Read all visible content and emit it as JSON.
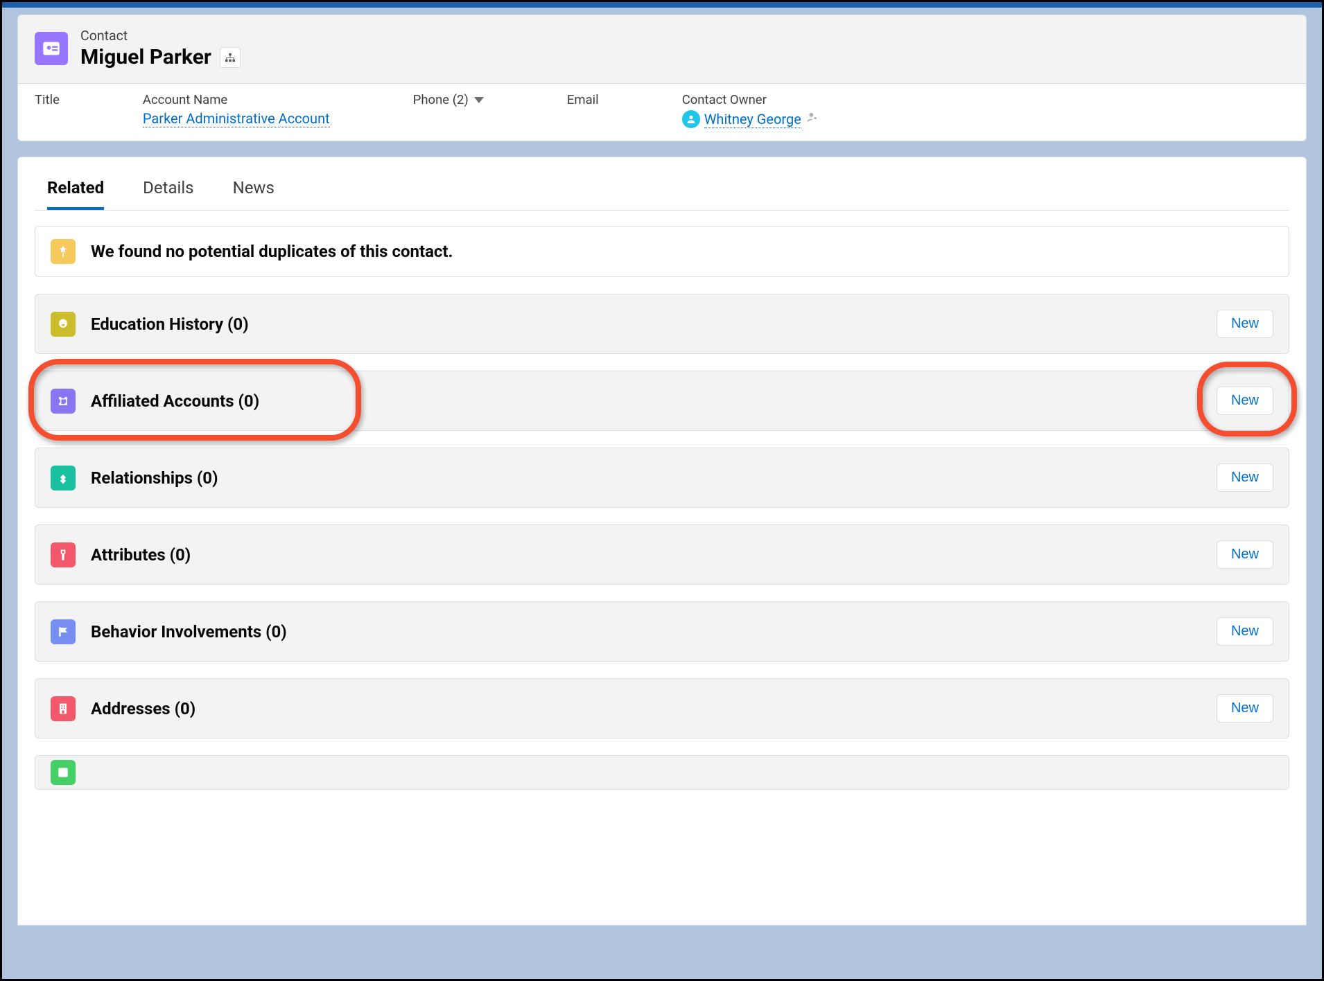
{
  "header": {
    "object_label": "Contact",
    "name": "Miguel Parker"
  },
  "highlights": {
    "title_label": "Title",
    "account_label": "Account Name",
    "account_value": "Parker Administrative Account",
    "phone_label": "Phone (2)",
    "email_label": "Email",
    "owner_label": "Contact Owner",
    "owner_value": "Whitney George"
  },
  "tabs": {
    "related": "Related",
    "details": "Details",
    "news": "News"
  },
  "duplicate_message": "We found no potential duplicates of this contact.",
  "buttons": {
    "new": "New"
  },
  "related": [
    {
      "title": "Education History (0)"
    },
    {
      "title": "Affiliated Accounts (0)"
    },
    {
      "title": "Relationships (0)"
    },
    {
      "title": "Attributes (0)"
    },
    {
      "title": "Behavior Involvements (0)"
    },
    {
      "title": "Addresses (0)"
    }
  ]
}
